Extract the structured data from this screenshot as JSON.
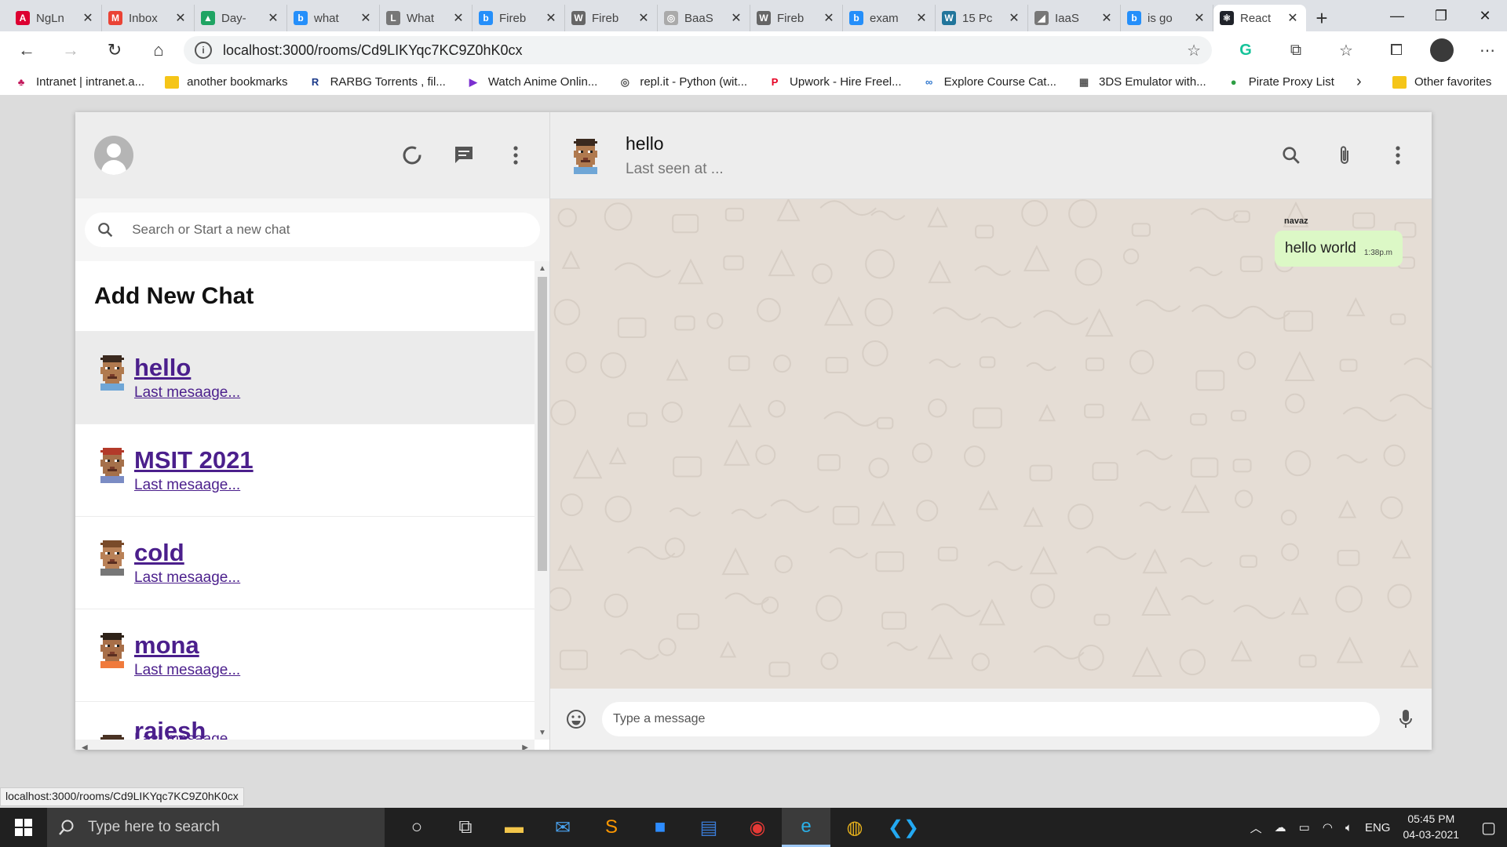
{
  "browser": {
    "tabs": [
      {
        "title": "NgLn",
        "icon": "angular-icon",
        "color": "#dd0031",
        "glyph": "A"
      },
      {
        "title": "Inbox",
        "icon": "gmail-icon",
        "color": "#ea4335",
        "glyph": "M"
      },
      {
        "title": "Day-",
        "icon": "drive-icon",
        "color": "#1fa463",
        "glyph": "▲"
      },
      {
        "title": "what",
        "icon": "bing-icon",
        "color": "#258ffa",
        "glyph": "b"
      },
      {
        "title": "What",
        "icon": "l-icon",
        "color": "#777777",
        "glyph": "L"
      },
      {
        "title": "Fireb",
        "icon": "bing-icon",
        "color": "#258ffa",
        "glyph": "b"
      },
      {
        "title": "Fireb",
        "icon": "wikipedia-icon",
        "color": "#666666",
        "glyph": "W"
      },
      {
        "title": "BaaS",
        "icon": "baas-icon",
        "color": "#aaaaaa",
        "glyph": "◎"
      },
      {
        "title": "Fireb",
        "icon": "wikipedia-icon",
        "color": "#666666",
        "glyph": "W"
      },
      {
        "title": "exam",
        "icon": "bing-icon",
        "color": "#258ffa",
        "glyph": "b"
      },
      {
        "title": "15 Pc",
        "icon": "wordpress-icon",
        "color": "#21759b",
        "glyph": "W"
      },
      {
        "title": "IaaS",
        "icon": "chart-icon",
        "color": "#777777",
        "glyph": "◢"
      },
      {
        "title": "is go",
        "icon": "bing-icon",
        "color": "#258ffa",
        "glyph": "b"
      },
      {
        "title": "React",
        "icon": "react-icon",
        "color": "#20232a",
        "glyph": "⚛",
        "active": true
      }
    ],
    "url": "localhost:3000/rooms/Cd9LIKYqc7KC9Z0hK0cx",
    "bookmarks": [
      {
        "label": "Intranet | intranet.a...",
        "icon": "intranet-icon",
        "color": "#c2185b",
        "glyph": "♣"
      },
      {
        "label": "another bookmarks",
        "icon": "folder-icon",
        "color": "#f5c518",
        "glyph": ""
      },
      {
        "label": "RARBG Torrents , fil...",
        "icon": "rarbg-icon",
        "color": "#1b3a8a",
        "glyph": "R"
      },
      {
        "label": "Watch Anime Onlin...",
        "icon": "play-icon",
        "color": "#7b2fd0",
        "glyph": "▶"
      },
      {
        "label": "repl.it - Python (wit...",
        "icon": "replit-icon",
        "color": "#555555",
        "glyph": "◎"
      },
      {
        "label": "Upwork - Hire Freel...",
        "icon": "pinterest-icon",
        "color": "#e60023",
        "glyph": "P"
      },
      {
        "label": "Explore Course Cat...",
        "icon": "coursera-icon",
        "color": "#2a73cc",
        "glyph": "∞"
      },
      {
        "label": "3DS Emulator with...",
        "icon": "emulator-icon",
        "color": "#555555",
        "glyph": "▦"
      },
      {
        "label": "Pirate Proxy List",
        "icon": "proxy-icon",
        "color": "#2e9e44",
        "glyph": "●"
      }
    ],
    "other_favorites": "Other favorites",
    "status_url": "localhost:3000/rooms/Cd9LIKYqc7KC9Z0hK0cx"
  },
  "sidebar": {
    "search_placeholder": "Search or Start a new chat",
    "add_new_chat": "Add New Chat",
    "chats": [
      {
        "name": "hello",
        "last": "Last mesaage..."
      },
      {
        "name": "MSIT 2021",
        "last": "Last mesaage..."
      },
      {
        "name": "cold",
        "last": "Last mesaage..."
      },
      {
        "name": "mona",
        "last": "Last mesaage..."
      },
      {
        "name": "rajesh",
        "last": "Last mesaage..."
      }
    ]
  },
  "chat": {
    "room_name": "hello",
    "last_seen": "Last seen at ...",
    "messages": [
      {
        "sender": "navaz",
        "text": "hello world",
        "time": "1:38p.m"
      }
    ],
    "input_placeholder": "Type a message"
  },
  "taskbar": {
    "search_placeholder": "Type here to search",
    "language": "ENG",
    "time": "05:45 PM",
    "date": "04-03-2021"
  },
  "colors": {
    "link_purple": "#4b1f8c",
    "bubble_green": "#dcf8c6",
    "chat_bg": "#e5ddd5",
    "header_gray": "#ededed"
  }
}
